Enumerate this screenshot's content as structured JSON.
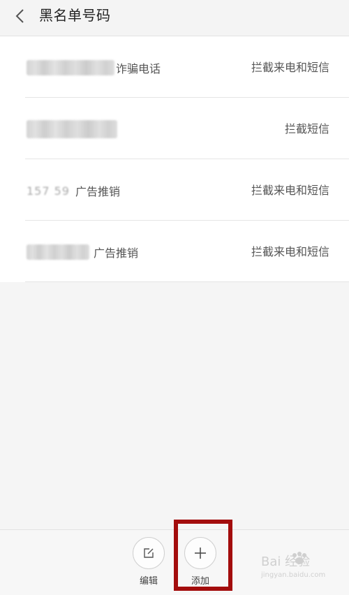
{
  "header": {
    "title": "黑名单号码",
    "back_icon": "chevron-left-icon"
  },
  "list": {
    "rows": [
      {
        "number_masked": "",
        "tag": "诈骗电话",
        "action": "拦截来电和短信"
      },
      {
        "number_masked": "",
        "tag": "",
        "action": "拦截短信"
      },
      {
        "number_masked": "157     59",
        "tag": "广告推销",
        "action": "拦截来电和短信"
      },
      {
        "number_masked": "",
        "tag": "广告推销",
        "action": "拦截来电和短信"
      }
    ]
  },
  "toolbar": {
    "edit_label": "编辑",
    "add_label": "添加",
    "edit_icon": "edit-icon",
    "add_icon": "plus-icon"
  },
  "annotation": {
    "highlight_color": "#a30d0d"
  },
  "watermark": {
    "text": "Bai 经验",
    "url_text": "jingyan.baidu.com"
  },
  "colors": {
    "background": "#f5f5f5",
    "list_background": "#ffffff",
    "text_primary": "#222222",
    "text_secondary": "#555555"
  }
}
